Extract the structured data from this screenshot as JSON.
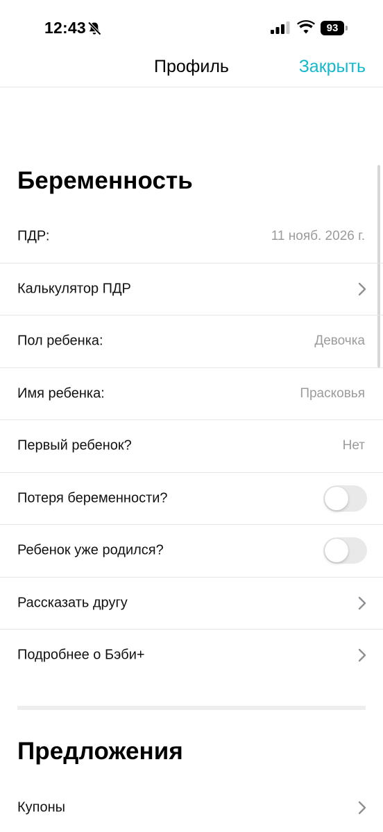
{
  "status_bar": {
    "time": "12:43",
    "battery": "93",
    "icons": [
      "bell-slash-icon",
      "cellular-signal-icon",
      "wifi-icon",
      "battery-icon"
    ]
  },
  "nav": {
    "title": "Профиль",
    "close_label": "Закрыть",
    "accent_color": "#16b8cc"
  },
  "pregnancy_section": {
    "title": "Беременность",
    "rows": [
      {
        "label": "ПДР:",
        "value": "11 нояб. 2026 г."
      },
      {
        "label": "Калькулятор ПДР",
        "icon": "chevron-right-icon"
      },
      {
        "label": "Пол ребенка:",
        "value": "Девочка"
      },
      {
        "label": "Имя ребенка:",
        "value": "Прасковья"
      },
      {
        "label": "Первый ребенок?",
        "value": "Нет"
      },
      {
        "label": "Потеря беременности?",
        "toggle": false
      },
      {
        "label": "Ребенок уже родился?",
        "toggle": false
      },
      {
        "label": "Рассказать другу",
        "icon": "chevron-right-icon"
      },
      {
        "label": "Подробнее о Бэби+",
        "icon": "chevron-right-icon"
      }
    ]
  },
  "offers_section": {
    "title": "Предложения",
    "rows": [
      {
        "label": "Купоны",
        "icon": "chevron-right-icon"
      }
    ]
  }
}
